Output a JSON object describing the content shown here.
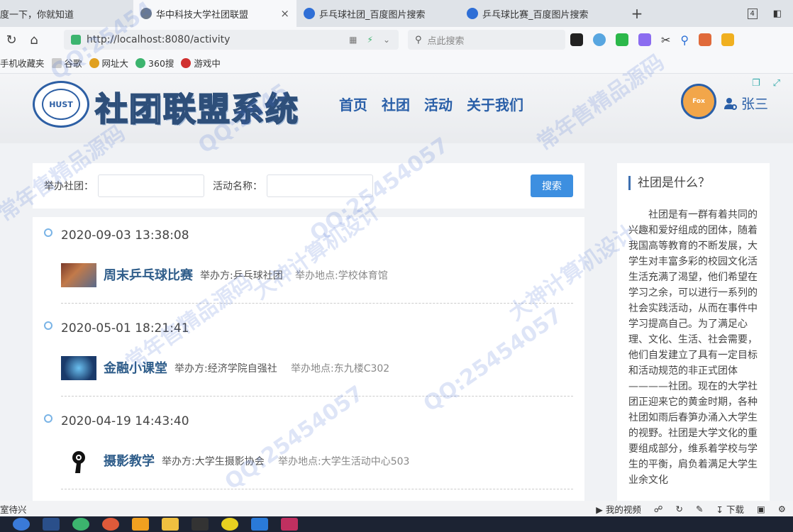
{
  "browser": {
    "tabs": [
      {
        "label": "度一下，你就知道",
        "color": "#ffffff"
      },
      {
        "label": "华中科技大学社团联盟",
        "color": "#6d7a8c"
      },
      {
        "label": "乒乓球社团_百度图片搜索",
        "color": "#2f6fd6"
      },
      {
        "label": "乒乓球比赛_百度图片搜索",
        "color": "#2f6fd6"
      }
    ],
    "tab_close": "×",
    "new_tab": "+",
    "tab_count": "4",
    "url": "http://localhost:8080/activity",
    "search_placeholder": "点此搜索",
    "bookmarks": [
      {
        "label": "手机收藏夹",
        "color": "#888888"
      },
      {
        "label": "谷歌",
        "color": "#999999"
      },
      {
        "label": "网址大",
        "color": "#e0a020"
      },
      {
        "label": "360搜",
        "color": "#3cb46e"
      },
      {
        "label": "游戏中",
        "color": "#d0302f"
      }
    ]
  },
  "site": {
    "logo_text": "HUST",
    "title": "社团联盟系统",
    "nav": [
      "首页",
      "社团",
      "活动",
      "关于我们"
    ],
    "avatar_text": "Fox",
    "username": "张三"
  },
  "search": {
    "club_label": "举办社团：",
    "club_value": "",
    "name_label": "活动名称：",
    "name_value": "",
    "button": "搜索"
  },
  "activities": [
    {
      "date": "2020-09-03 13:38:08",
      "name": "周末乒乓球比赛",
      "organizer": "举办方:乒乓球社团",
      "location": "举办地点:学校体育馆"
    },
    {
      "date": "2020-05-01 18:21:41",
      "name": "金融小课堂",
      "organizer": "举办方:经济学院自强社",
      "location": "举办地点:东九楼C302"
    },
    {
      "date": "2020-04-19 14:43:40",
      "name": "摄影教学",
      "organizer": "举办方:大学生摄影协会",
      "location": "举办地点:大学生活动中心503"
    }
  ],
  "sidebar": {
    "title": "社团是什么？",
    "text": "社团是有一群有着共同的兴趣和爱好组成的团体，随着我国高等教育的不断发展，大学生对丰富多彩的校园文化活生活充满了渴望，他们希望在学习之余，可以进行一系列的社会实践活动，从而在事件中学习提高自己。为了满足心理、文化、生活、社会需要，他们自发建立了具有一定目标和活动规范的非正式团体————社团。现在的大学社团正迎来它的黄金时期，各种社团如雨后春笋办涌入大学生的视野。社团是大学文化的重要组成部分，维系着学校与学生的平衡，肩负着满足大学生业余文化"
  },
  "statusbar": {
    "left": "室待兴",
    "video": "我的视频",
    "download": "下载"
  },
  "watermarks": [
    "QQ:25454",
    "常年售精品源码",
    "QQ:2545",
    "大神计算机设计",
    "QQ:25454057",
    "常年售精品源码",
    "QQ:25454057",
    "大神计算机设计",
    "常年售精品源码",
    "QQ:25454057"
  ]
}
